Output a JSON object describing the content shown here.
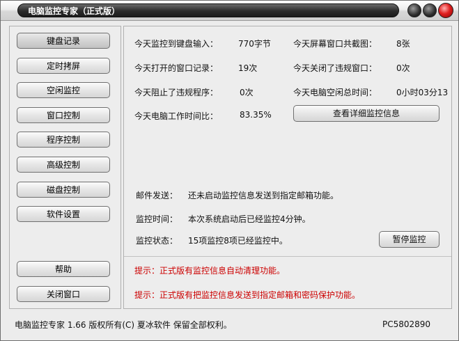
{
  "window": {
    "title": "电脑监控专家（正式版）"
  },
  "sidebar": {
    "items": [
      {
        "label": "键盘记录"
      },
      {
        "label": "定时拷屏"
      },
      {
        "label": "空闲监控"
      },
      {
        "label": "窗口控制"
      },
      {
        "label": "程序控制"
      },
      {
        "label": "高级控制"
      },
      {
        "label": "磁盘控制"
      },
      {
        "label": "软件设置"
      }
    ],
    "help_label": "帮助",
    "close_label": "关闭窗口"
  },
  "stats": {
    "keyboard_label": "今天监控到键盘输入：",
    "keyboard_value": "770字节",
    "screenshots_label": "今天屏幕窗口共截图：",
    "screenshots_value": "8张",
    "windows_opened_label": "今天打开的窗口记录：",
    "windows_opened_value": "19次",
    "windows_closed_label": "今天关闭了违规窗口：",
    "windows_closed_value": "0次",
    "programs_blocked_label": "今天阻止了违规程序：",
    "programs_blocked_value": "0次",
    "idle_time_label": "今天电脑空闲总时间：",
    "idle_time_value": "0小时03分13",
    "work_ratio_label": "今天电脑工作时间比：",
    "work_ratio_value": "83.35%",
    "view_details_label": "查看详细监控信息"
  },
  "info": {
    "email_label": "邮件发送：",
    "email_value": "还未启动监控信息发送到指定邮箱功能。",
    "time_label": "监控时间：",
    "time_value": "本次系统启动后已经监控4分钟。",
    "status_label": "监控状态：",
    "status_value": "15项监控8项已经监控中。",
    "pause_label": "暂停监控"
  },
  "tips": {
    "tip1": "提示：正式版有监控信息自动清理功能。",
    "tip2": "提示：正式版有把监控信息发送到指定邮箱和密码保护功能。"
  },
  "footer": {
    "copyright": "电脑监控专家  1.66  版权所有(C)  夏冰软件  保留全部权利。",
    "machine_id": "PC5802890"
  },
  "colors": {
    "tip_text": "#cc0000",
    "close_button": "#e02020"
  }
}
